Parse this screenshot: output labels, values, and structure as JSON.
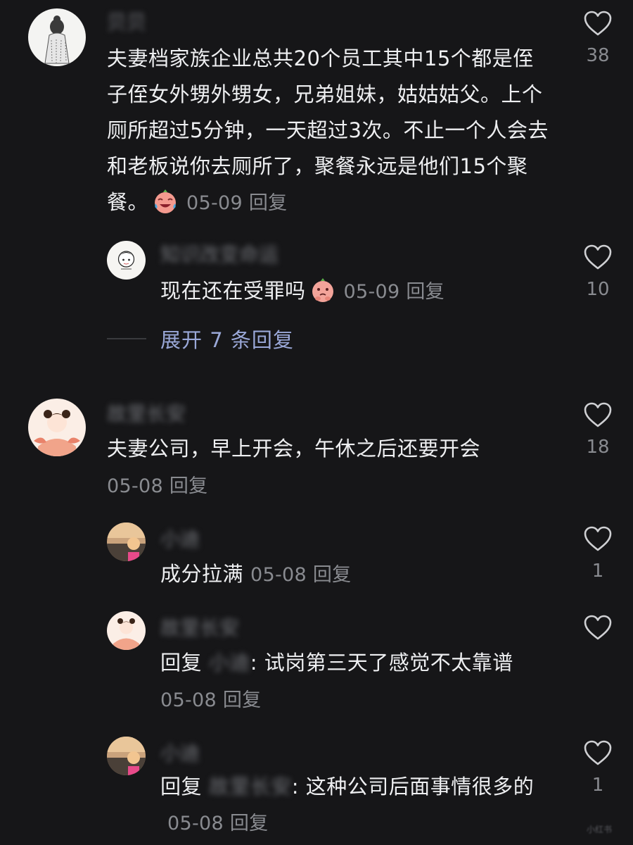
{
  "comments": [
    {
      "id": "c1",
      "username": "贝贝",
      "text": "夫妻档家族企业总共20个员工其中15个都是侄子侄女外甥外甥女，兄弟姐妹，姑姑姑父。上个厕所超过5分钟，一天超过3次。不止一个人会去和老板说你去厕所了，聚餐永远是他们15个聚餐。",
      "date": "05-09",
      "reply_label": "回复",
      "likes": "38",
      "emoji": "crying-laughing-peach-emoji"
    },
    {
      "id": "c1r1",
      "username": "知识改变命运",
      "text": "现在还在受罪吗",
      "date": "05-09",
      "reply_label": "回复",
      "likes": "10",
      "emoji": "pleading-peach-emoji"
    },
    {
      "id": "c2",
      "username": "故里长安",
      "text": "夫妻公司，早上开会，午休之后还要开会",
      "date": "05-08",
      "reply_label": "回复",
      "likes": "18"
    },
    {
      "id": "c2r1",
      "username": "小迪",
      "text": "成分拉满",
      "date": "05-08",
      "reply_label": "回复",
      "likes": "1"
    },
    {
      "id": "c2r2",
      "username": "故里长安",
      "reply_prefix": "回复",
      "reply_to": "小迪",
      "text": ": 试岗第三天了感觉不太靠谱",
      "date": "05-08",
      "reply_label": "回复",
      "likes": ""
    },
    {
      "id": "c2r3",
      "username": "小迪",
      "reply_prefix": "回复",
      "reply_to": "故里长安",
      "text": ": 这种公司后面事情很多的",
      "date": "05-08",
      "reply_label": "回复",
      "likes": "1"
    }
  ],
  "expand_label": "展开 7 条回复",
  "watermark": "小红书",
  "icons": {
    "like": "heart-outline-icon"
  },
  "colors": {
    "background": "#161618",
    "text": "#eeeff1",
    "meta": "#898b90",
    "link": "#9aa8d8"
  }
}
